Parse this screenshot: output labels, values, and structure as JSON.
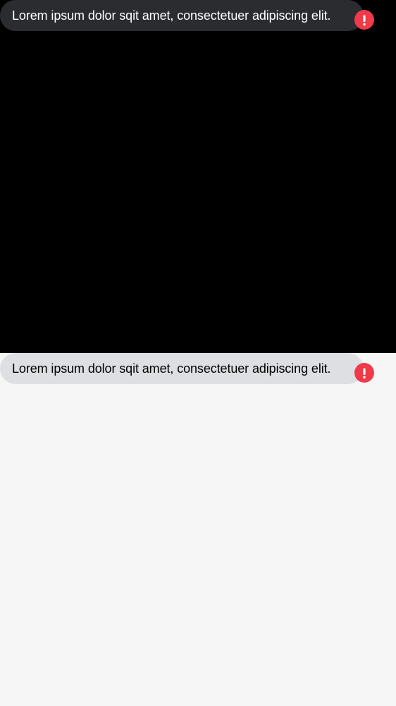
{
  "dark_theme": {
    "message": {
      "text": "Lorem ipsum dolor sqit amet, consectetuer adipiscing elit.",
      "status_icon": "error-exclamation-icon",
      "bubble_color": "#2b2c30",
      "text_color": "#ffffff"
    },
    "background_color": "#000000"
  },
  "light_theme": {
    "message": {
      "text": "Lorem ipsum dolor sqit amet, consectetuer adipiscing elit.",
      "status_icon": "error-exclamation-icon",
      "bubble_color": "#dedfe3",
      "text_color": "#000000"
    },
    "background_color": "#f6f6f6"
  },
  "colors": {
    "error": "#f03a4a"
  }
}
